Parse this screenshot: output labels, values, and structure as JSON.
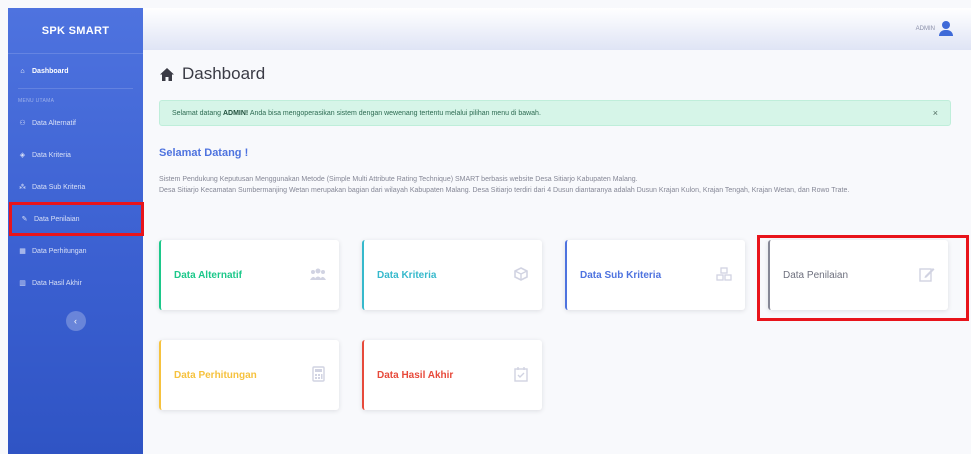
{
  "sidebar": {
    "brand": "SPK SMART",
    "dashboard": "Dashboard",
    "heading": "MENU UTAMA",
    "items": [
      {
        "label": "Data Alternatif",
        "icon": "users-icon"
      },
      {
        "label": "Data Kriteria",
        "icon": "cube-icon"
      },
      {
        "label": "Data Sub Kriteria",
        "icon": "cubes-icon"
      },
      {
        "label": "Data Penilaian",
        "icon": "edit-icon"
      },
      {
        "label": "Data Perhitungan",
        "icon": "calculator-icon"
      },
      {
        "label": "Data Hasil Akhir",
        "icon": "chart-icon"
      }
    ]
  },
  "topbar": {
    "user": "ADMIN"
  },
  "main": {
    "title": "Dashboard",
    "alert": {
      "prefix": "Selamat datang ",
      "name": "ADMIN!",
      "suffix": " Anda bisa mengoperasikan sistem dengan wewenang tertentu melalui pilihan menu di bawah.",
      "close": "×"
    },
    "welcome": "Selamat Datang !",
    "desc_line1": "Sistem Pendukung Keputusan Menggunakan Metode (Simple Multi Attribute Rating Technique) SMART berbasis website Desa Sitiarjo Kabupaten Malang.",
    "desc_line2": "Desa Sitiarjo Kecamatan Sumbermanjing Wetan merupakan bagian dari wilayah Kabupaten Malang. Desa Sitiarjo terdiri dari 4 Dusun diantaranya adalah Dusun Krajan Kulon, Krajan Tengah, Krajan Wetan, dan Rowo Trate.",
    "cards": [
      {
        "label": "Data Alternatif",
        "icon": "users-icon"
      },
      {
        "label": "Data Kriteria",
        "icon": "cube-icon"
      },
      {
        "label": "Data Sub Kriteria",
        "icon": "cubes-icon"
      },
      {
        "label": "Data Penilaian",
        "icon": "edit-icon"
      },
      {
        "label": "Data Perhitungan",
        "icon": "calculator-icon"
      },
      {
        "label": "Data Hasil Akhir",
        "icon": "calendar-check-icon"
      }
    ]
  },
  "colors": {
    "sidebar": "#4e73df",
    "highlight": "#e8141b",
    "success": "#1cc88a",
    "info": "#36b9cc",
    "primary": "#4e73df",
    "secondary": "#858796",
    "warning": "#f6c23e",
    "danger": "#e74a3b"
  }
}
